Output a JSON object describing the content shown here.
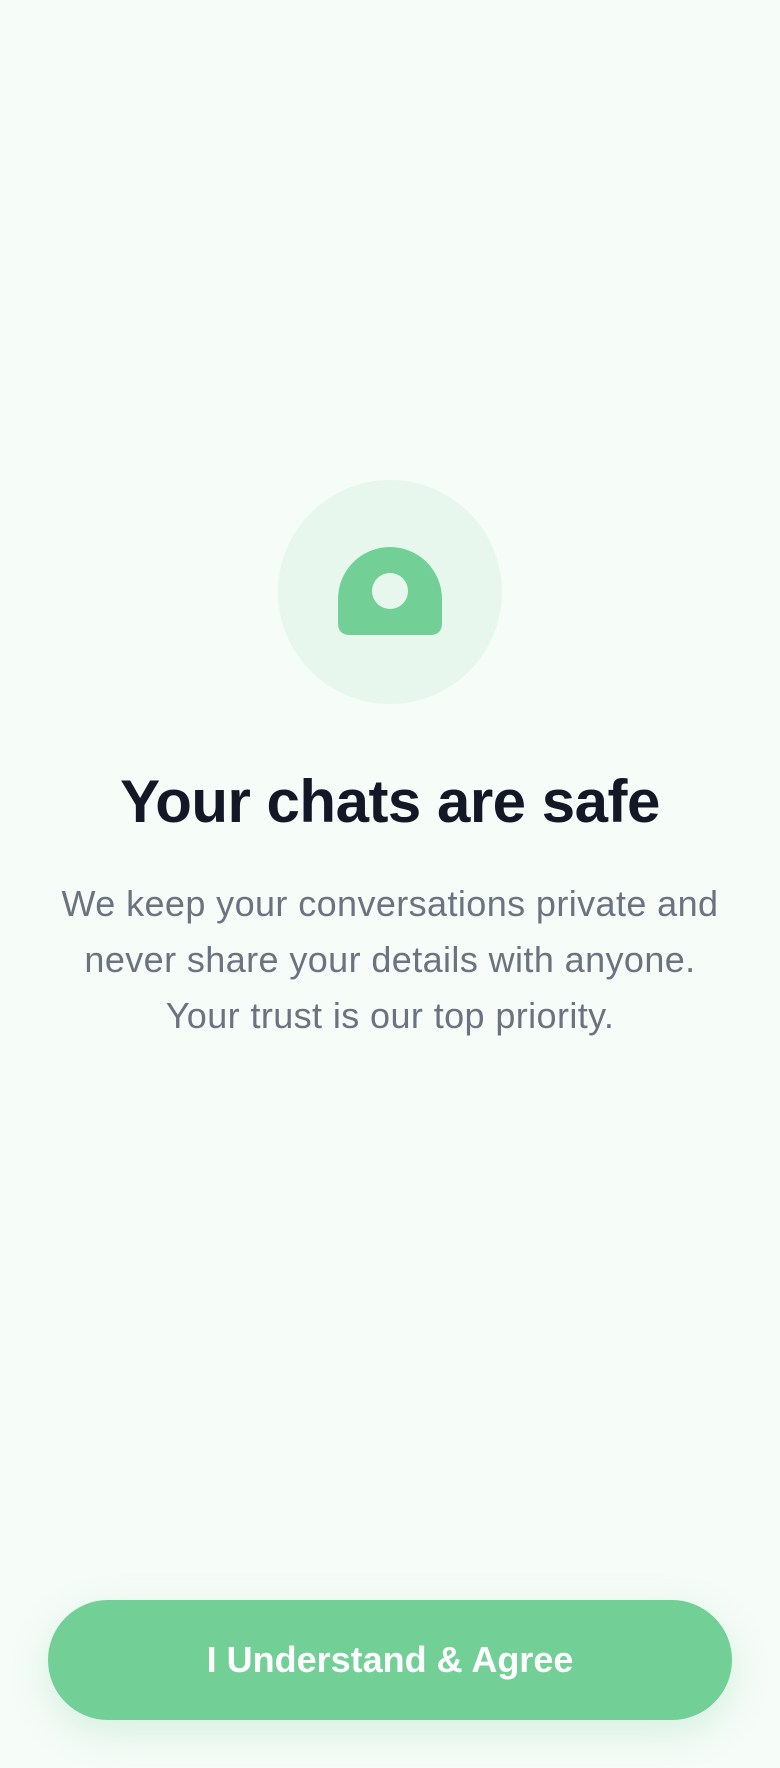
{
  "onboarding": {
    "icon": "lock-shield-icon",
    "title": "Your chats are safe",
    "description": "We keep your conversations private and never share your details with anyone. Your trust is our top priority.",
    "agree_button_label": "I Understand & Agree"
  },
  "colors": {
    "background": "#f6fcf8",
    "accent": "#72d097",
    "icon_circle": "#e8f7ee",
    "title": "#121826",
    "body_text": "#6b7280"
  }
}
